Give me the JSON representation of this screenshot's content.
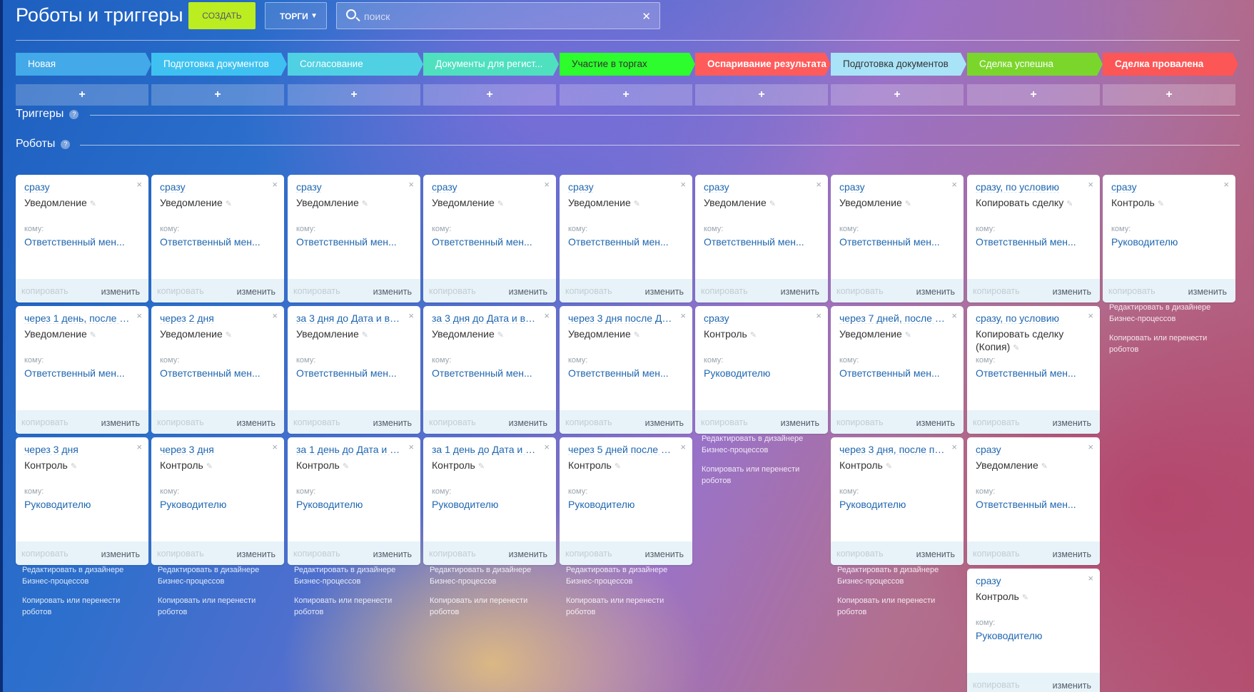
{
  "header": {
    "title": "Роботы и триггеры",
    "create_label": "СОЗДАТЬ",
    "pipeline_label": "ТОРГИ",
    "search_placeholder": "поиск"
  },
  "stages": [
    {
      "label": "Новая",
      "color": "#43a9e8"
    },
    {
      "label": "Подготовка документов",
      "color": "#3ec1f0"
    },
    {
      "label": "Согласование",
      "color": "#4fd0e3"
    },
    {
      "label": "Документы для регист...",
      "color": "#4fe0c0"
    },
    {
      "label": "Участие в торгах",
      "color": "#2dfc2d"
    },
    {
      "label": "Оспаривание результата",
      "color": "#ff5b5b"
    },
    {
      "label": "Подготовка документов",
      "color": "#a9e3f8"
    },
    {
      "label": "Сделка успешна",
      "color": "#7bd62c"
    },
    {
      "label": "Сделка провалена",
      "color": "#fc5656"
    }
  ],
  "add_label": "+",
  "sections": {
    "triggers": "Триггеры",
    "robots": "Роботы",
    "help": "?"
  },
  "common": {
    "to_label": "кому:",
    "copy_label": "копировать",
    "edit_label": "изменить",
    "pen": "✎",
    "close": "×"
  },
  "designer_links": {
    "edit": "Редактировать в дизайнере Бизнес-процессов",
    "copy": "Копировать или перенести роботов"
  },
  "columns": [
    {
      "robots": [
        {
          "delay": "сразу",
          "action": "Уведомление",
          "to": "Ответственный мен..."
        },
        {
          "delay": "через 1 день, после п...",
          "action": "Уведомление",
          "to": "Ответственный мен..."
        },
        {
          "delay": "через 3 дня",
          "action": "Контроль",
          "to": "Руководителю"
        }
      ]
    },
    {
      "robots": [
        {
          "delay": "сразу",
          "action": "Уведомление",
          "to": "Ответственный мен..."
        },
        {
          "delay": "через 2 дня",
          "action": "Уведомление",
          "to": "Ответственный мен..."
        },
        {
          "delay": "через 3 дня",
          "action": "Контроль",
          "to": "Руководителю"
        }
      ]
    },
    {
      "robots": [
        {
          "delay": "сразу",
          "action": "Уведомление",
          "to": "Ответственный мен..."
        },
        {
          "delay": "за 3 дня до Дата и вре...",
          "action": "Уведомление",
          "to": "Ответственный мен..."
        },
        {
          "delay": "за 1 день до Дата и вр...",
          "action": "Контроль",
          "to": "Руководителю"
        }
      ]
    },
    {
      "robots": [
        {
          "delay": "сразу",
          "action": "Уведомление",
          "to": "Ответственный мен..."
        },
        {
          "delay": "за 3 дня до Дата и вре...",
          "action": "Уведомление",
          "to": "Ответственный мен..."
        },
        {
          "delay": "за 1 день до Дата и вр...",
          "action": "Контроль",
          "to": "Руководителю"
        }
      ]
    },
    {
      "robots": [
        {
          "delay": "сразу",
          "action": "Уведомление",
          "to": "Ответственный мен..."
        },
        {
          "delay": "через 3 дня после Дат...",
          "action": "Уведомление",
          "to": "Ответственный мен..."
        },
        {
          "delay": "через 5 дней после Д...",
          "action": "Контроль",
          "to": "Руководителю"
        }
      ]
    },
    {
      "robots": [
        {
          "delay": "сразу",
          "action": "Уведомление",
          "to": "Ответственный мен..."
        },
        {
          "delay": "сразу",
          "action": "Контроль",
          "to": "Руководителю"
        }
      ]
    },
    {
      "robots": [
        {
          "delay": "сразу",
          "action": "Уведомление",
          "to": "Ответственный мен..."
        },
        {
          "delay": "через 7 дней, после п...",
          "action": "Уведомление",
          "to": "Ответственный мен..."
        },
        {
          "delay": "через 3 дня, после пр...",
          "action": "Контроль",
          "to": "Руководителю"
        }
      ]
    },
    {
      "robots": [
        {
          "delay": "сразу, по условию",
          "action": "Копировать сделку",
          "to": "Ответственный мен..."
        },
        {
          "delay": "сразу, по условию",
          "action": "Копировать сделку (Копия)",
          "to": "Ответственный мен..."
        },
        {
          "delay": "сразу",
          "action": "Уведомление",
          "to": "Ответственный мен..."
        },
        {
          "delay": "сразу",
          "action": "Контроль",
          "to": "Руководителю"
        }
      ]
    },
    {
      "robots": [
        {
          "delay": "сразу",
          "action": "Контроль",
          "to": "Руководителю"
        }
      ]
    }
  ]
}
